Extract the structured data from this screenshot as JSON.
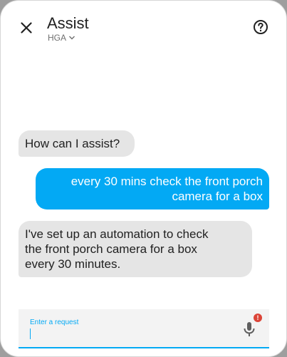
{
  "header": {
    "title": "Assist",
    "pipeline": "HGA"
  },
  "messages": [
    {
      "from": "assistant",
      "text": "How can I assist?"
    },
    {
      "from": "user",
      "lines": [
        "every 30 mins check the front porch",
        "camera for a box"
      ]
    },
    {
      "from": "assistant",
      "lines": [
        "I've set up an automation to check",
        "the front porch camera for a box",
        "every 30 minutes."
      ]
    }
  ],
  "input": {
    "label": "Enter a request",
    "value": ""
  },
  "mic": {
    "badge": "!"
  },
  "colors": {
    "accent": "#03a9f4",
    "assistant_bubble": "#e5e5e5",
    "alert": "#db4437"
  },
  "icons": {
    "close": "close-icon",
    "help": "help-circle-icon",
    "dropdown": "chevron-down-icon",
    "mic": "microphone-icon"
  }
}
